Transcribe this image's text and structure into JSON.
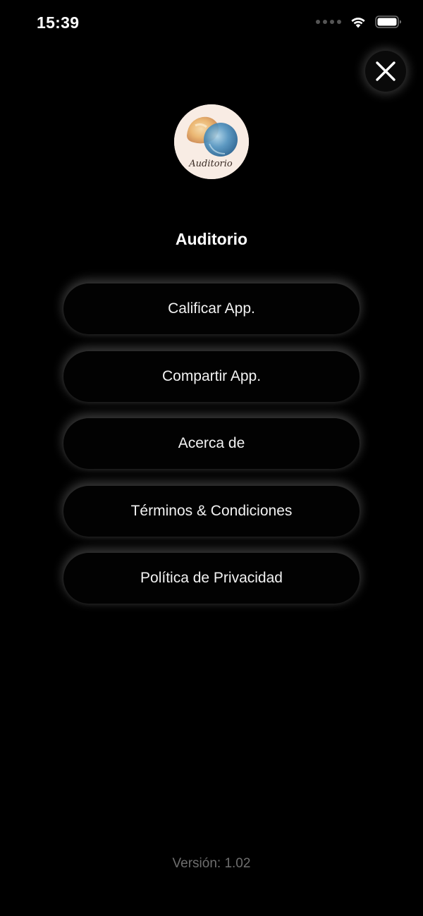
{
  "status_bar": {
    "time": "15:39",
    "icons": [
      "signal-dots-icon",
      "wifi-icon",
      "battery-icon"
    ]
  },
  "close": {
    "icon": "close-icon"
  },
  "app": {
    "logo_text": "Auditorio",
    "title": "Auditorio"
  },
  "menu": {
    "items": [
      {
        "label": "Calificar App."
      },
      {
        "label": "Compartir App."
      },
      {
        "label": "Acerca de"
      },
      {
        "label": "Términos & Condiciones"
      },
      {
        "label": "Política de Privacidad"
      }
    ]
  },
  "footer": {
    "version": "Versión: 1.02"
  },
  "colors": {
    "background": "#000000",
    "text": "#ffffff",
    "version_text": "#6e6e6e",
    "glow": "#ffffff"
  }
}
